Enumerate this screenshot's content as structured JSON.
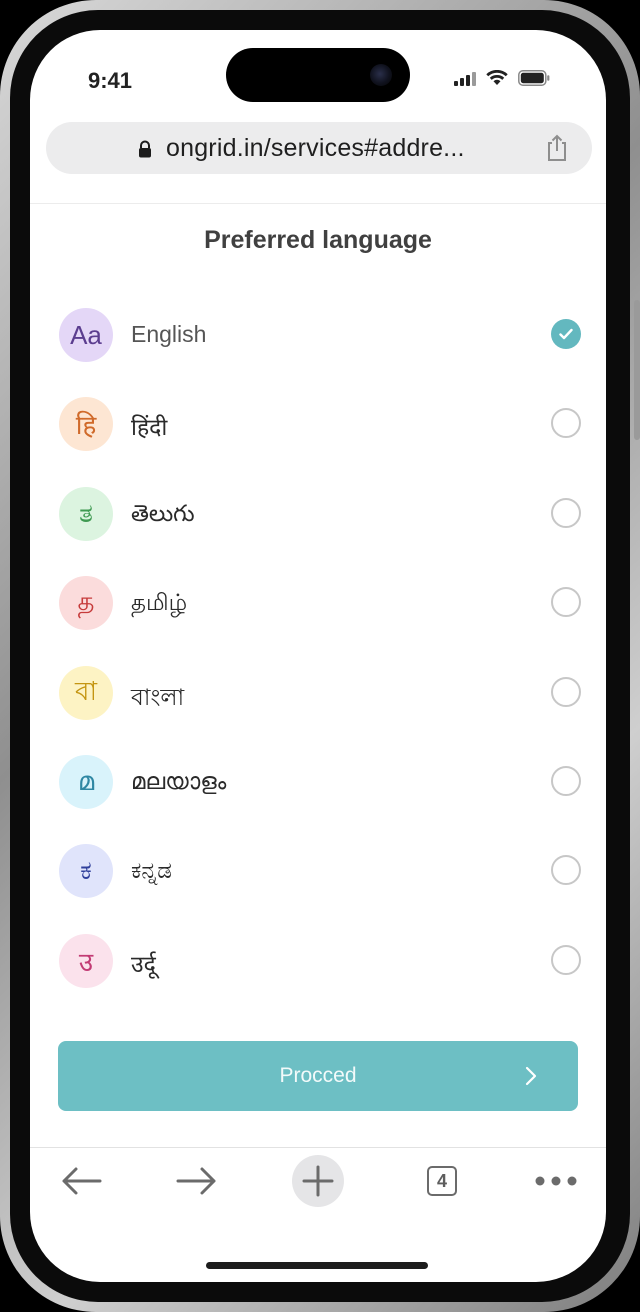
{
  "status_bar": {
    "time": "9:41"
  },
  "browser": {
    "url": "ongrid.in/services#addre...",
    "tab_count": "4"
  },
  "page": {
    "title": "Preferred language",
    "selected_language": "English",
    "languages": [
      {
        "glyph": "Aa",
        "label": "English",
        "selected": true,
        "avatar_bg": "#e4d7f7",
        "glyph_color": "#5b3d8f"
      },
      {
        "glyph": "हि",
        "label": "हिंदी",
        "selected": false,
        "avatar_bg": "#fde6d3",
        "glyph_color": "#d06a2a"
      },
      {
        "glyph": "ತ",
        "label": "తెలుగు",
        "selected": false,
        "avatar_bg": "#dcf4e0",
        "glyph_color": "#3f9a52"
      },
      {
        "glyph": "த",
        "label": "தமிழ்",
        "selected": false,
        "avatar_bg": "#fbdcdc",
        "glyph_color": "#c63b3b"
      },
      {
        "glyph": "বা",
        "label": "বাংলা",
        "selected": false,
        "avatar_bg": "#fdf3c4",
        "glyph_color": "#c49512"
      },
      {
        "glyph": "മ",
        "label": "മലയാളം",
        "selected": false,
        "avatar_bg": "#d9f3fb",
        "glyph_color": "#2f87a3"
      },
      {
        "glyph": "ಕ",
        "label": "ಕನ್ನಡ",
        "selected": false,
        "avatar_bg": "#e0e4fb",
        "glyph_color": "#2f3f9b"
      },
      {
        "glyph": "उ",
        "label": "उर्दू",
        "selected": false,
        "avatar_bg": "#fbe2ec",
        "glyph_color": "#c23b74"
      }
    ],
    "proceed_label": "Procced"
  },
  "colors": {
    "accent": "#63b8bf",
    "button": "#6dbfc4"
  },
  "icons": {
    "lock": "lock-icon",
    "share": "share-icon",
    "check": "check-icon",
    "chevron": "chevron-right-icon",
    "back": "arrow-left-icon",
    "forward": "arrow-right-icon",
    "new_tab": "plus-icon",
    "more": "more-dots-icon"
  }
}
